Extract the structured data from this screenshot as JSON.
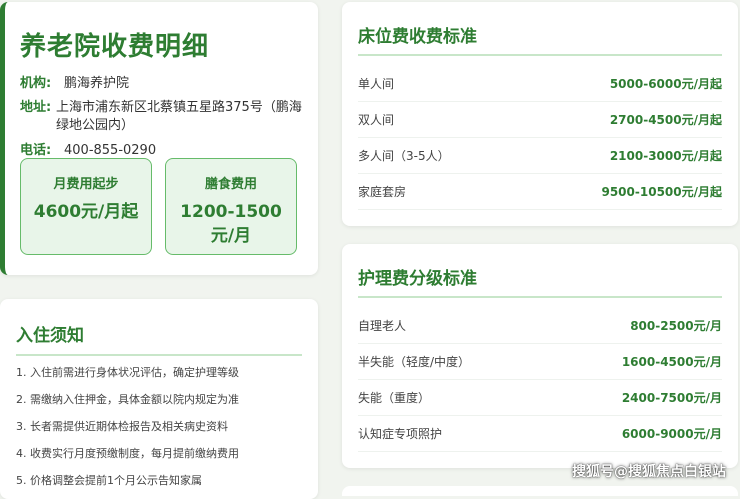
{
  "facility": {
    "title": "养老院收费明细",
    "org_label": "机构:",
    "org_value": "鹏海养护院",
    "address_label": "地址:",
    "address_value": "上海市浦东新区北蔡镇五星路375号（鹏海绿地公园内）",
    "phone_label": "电话:",
    "phone_value": "400-855-0290",
    "monthly_box": {
      "label": "月费用起步",
      "value": "4600元/月起"
    },
    "meal_box": {
      "label": "膳食费用",
      "value": "1200-1500元/月"
    }
  },
  "notice": {
    "heading": "入住须知",
    "items": [
      "1. 入住前需进行身体状况评估，确定护理等级",
      "2. 需缴纳入住押金，具体金额以院内规定为准",
      "3. 长者需提供近期体检报告及相关病史资料",
      "4. 收费实行月度预缴制度，每月提前缴纳费用",
      "5. 价格调整会提前1个月公示告知家属"
    ]
  },
  "bed": {
    "heading": "床位费收费标准",
    "rows": [
      {
        "name": "单人间",
        "price": "5000-6000元/月起"
      },
      {
        "name": "双人间",
        "price": "2700-4500元/月起"
      },
      {
        "name": "多人间（3-5人）",
        "price": "2100-3000元/月起"
      },
      {
        "name": "家庭套房",
        "price": "9500-10500元/月起"
      }
    ]
  },
  "care": {
    "heading": "护理费分级标准",
    "rows": [
      {
        "name": "自理老人",
        "price": "800-2500元/月"
      },
      {
        "name": "半失能（轻度/中度）",
        "price": "1600-4500元/月"
      },
      {
        "name": "失能（重度）",
        "price": "2400-7500元/月"
      },
      {
        "name": "认知症专项照护",
        "price": "6000-9000元/月"
      }
    ]
  },
  "watermark": "搜狐号@搜狐焦点白银站",
  "colors": {
    "accent": "#2e7d32",
    "box_bg": "#e8f5e9",
    "box_border": "#66bb6a",
    "page_bg": "#f1f4ef"
  }
}
